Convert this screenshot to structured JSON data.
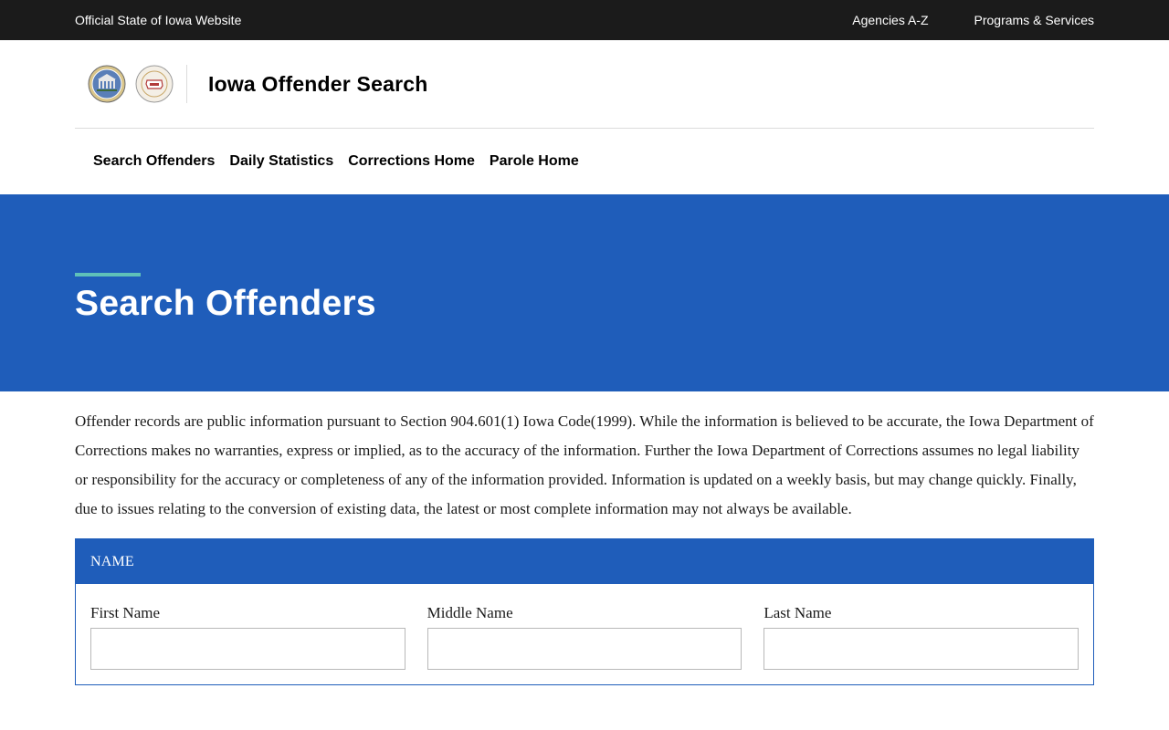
{
  "topbar": {
    "official": "Official State of Iowa Website",
    "links": [
      "Agencies A-Z",
      "Programs & Services"
    ]
  },
  "header": {
    "title": "Iowa Offender Search",
    "logos": [
      "iowa-department-of-corrections-seal",
      "iowa-board-of-parole-seal"
    ]
  },
  "nav": {
    "items": [
      "Search Offenders",
      "Daily Statistics",
      "Corrections Home",
      "Parole Home"
    ]
  },
  "hero": {
    "title": "Search Offenders"
  },
  "disclaimer": "Offender records are public information pursuant to Section 904.601(1) Iowa Code(1999). While the information is believed to be accurate, the Iowa Department of Corrections makes no warranties, express or implied, as to the accuracy of the information. Further the Iowa Department of Corrections assumes no legal liability or responsibility for the accuracy or completeness of any of the information provided. Information is updated on a weekly basis, but may change quickly. Finally, due to issues relating to the conversion of existing data, the latest or most complete information may not always be available.",
  "name_section": {
    "heading": "NAME",
    "fields": [
      {
        "label": "First Name",
        "value": ""
      },
      {
        "label": "Middle Name",
        "value": ""
      },
      {
        "label": "Last Name",
        "value": ""
      }
    ]
  },
  "colors": {
    "topbar": "#1b1b1b",
    "primary": "#1f5dba",
    "accent": "#5fc1b9"
  }
}
